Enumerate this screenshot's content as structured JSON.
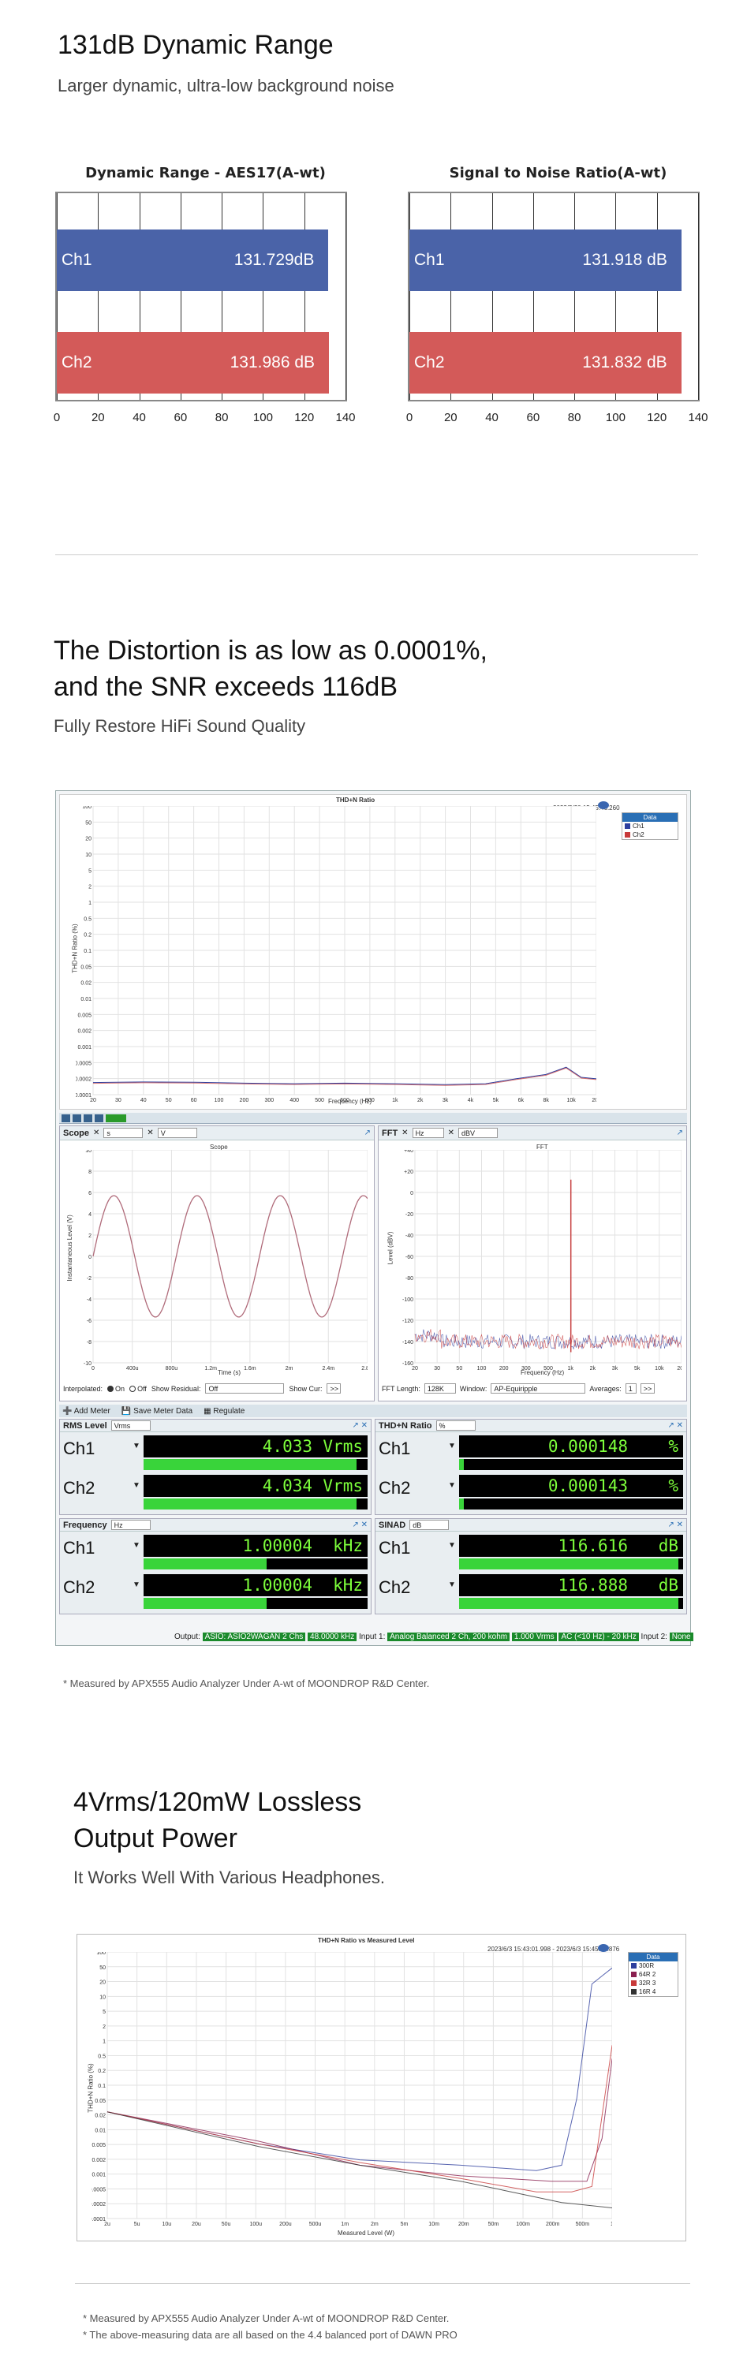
{
  "section1": {
    "title": "131dB Dynamic Range",
    "subtitle": "Larger dynamic, ultra-low background noise"
  },
  "chart_data": [
    {
      "type": "bar",
      "title": "Dynamic Range - AES17(A-wt)",
      "categories": [
        "Ch1",
        "Ch2"
      ],
      "values": [
        131.729,
        131.986
      ],
      "value_labels": [
        "131.729dB",
        "131.986 dB"
      ],
      "colors": [
        "#4a63a8",
        "#d35a59"
      ],
      "xlim": [
        0,
        140
      ],
      "ticks": [
        "0",
        "20",
        "40",
        "60",
        "80",
        "100",
        "120",
        "140"
      ]
    },
    {
      "type": "bar",
      "title": "Signal to Noise Ratio(A-wt)",
      "categories": [
        "Ch1",
        "Ch2"
      ],
      "values": [
        131.918,
        131.832
      ],
      "value_labels": [
        "131.918 dB",
        "131.832 dB"
      ],
      "colors": [
        "#4a63a8",
        "#d35a59"
      ],
      "xlim": [
        0,
        140
      ],
      "ticks": [
        "0",
        "20",
        "40",
        "60",
        "80",
        "100",
        "120",
        "140"
      ]
    }
  ],
  "section2": {
    "title_line1": "The Distortion is as low as 0.0001%,",
    "title_line2": "and the SNR exceeds 116dB",
    "subtitle": "Fully Restore HiFi Sound Quality",
    "note": "* Measured by APX555 Audio Analyzer Under A-wt of MOONDROP R&D Center."
  },
  "thdn_chart": {
    "title": "THD+N Ratio",
    "timestamp": "2023/5/30 15:45:46.260",
    "ylabel": "THD+N Ratio (%)",
    "xlabel": "Frequency (Hz)",
    "yticks": [
      "100",
      "50",
      "20",
      "10",
      "5",
      "2",
      "1",
      "0.5",
      "0.2",
      "0.1",
      "0.05",
      "0.02",
      "0.01",
      "0.005",
      "0.002",
      "0.001",
      "0.0005",
      "0.0002",
      "0.0001"
    ],
    "xticks": [
      "20",
      "30",
      "40",
      "50",
      "60",
      "100",
      "200",
      "300",
      "400",
      "500",
      "600",
      "800",
      "1k",
      "2k",
      "3k",
      "4k",
      "5k",
      "6k",
      "8k",
      "10k",
      "20k"
    ],
    "legend_title": "Data",
    "legend": [
      "Ch1",
      "Ch2"
    ]
  },
  "scope": {
    "label": "Scope",
    "unit_x": "s",
    "unit_y": "V",
    "title": "Scope",
    "ylabel": "Instantaneous Level (V)",
    "xlabel": "Time (s)",
    "yticks": [
      "10",
      "8",
      "6",
      "4",
      "2",
      "0",
      "-2",
      "-4",
      "-6",
      "-8",
      "-10"
    ],
    "xticks": [
      "0",
      "400u",
      "800u",
      "1.2m",
      "1.6m",
      "2m",
      "2.4m",
      "2.8m"
    ],
    "interpolated": "Interpolated:",
    "on": "On",
    "off": "Off",
    "show_residual": "Show Residual:",
    "residual_value": "Off",
    "show_cur": "Show Cur:"
  },
  "fft": {
    "label": "FFT",
    "unit_x": "Hz",
    "unit_y": "dBV",
    "title": "FFT",
    "ylabel": "Level (dBV)",
    "xlabel": "Frequency (Hz)",
    "yticks": [
      "+40",
      "+20",
      "0",
      "-20",
      "-40",
      "-60",
      "-80",
      "-100",
      "-120",
      "-140",
      "-160"
    ],
    "xticks": [
      "20",
      "30",
      "50",
      "100",
      "200",
      "300",
      "500",
      "1k",
      "2k",
      "3k",
      "5k",
      "10k",
      "20k"
    ],
    "fft_length_label": "FFT Length:",
    "fft_length": "128K",
    "window_label": "Window:",
    "window": "AP-Equiripple",
    "averages_label": "Averages:",
    "averages": "1"
  },
  "meters_toolbar": {
    "add_meter": "Add Meter",
    "save_meter": "Save Meter Data",
    "regulate": "Regulate"
  },
  "meters": [
    {
      "name": "RMS Level",
      "unit_sel": "Vrms",
      "ch1": "4.033",
      "ch2": "4.034",
      "unit": "Vrms",
      "fill1": 0.95,
      "fill2": 0.95
    },
    {
      "name": "THD+N Ratio",
      "unit_sel": "%",
      "ch1": "0.000148",
      "ch2": "0.000143",
      "unit": "%",
      "fill1": 0.02,
      "fill2": 0.02
    },
    {
      "name": "Frequency",
      "unit_sel": "Hz",
      "ch1": "1.00004",
      "ch2": "1.00004",
      "unit": "kHz",
      "fill1": 0.55,
      "fill2": 0.55
    },
    {
      "name": "SINAD",
      "unit_sel": "dB",
      "ch1": "116.616",
      "ch2": "116.888",
      "unit": "dB",
      "fill1": 0.98,
      "fill2": 0.98
    }
  ],
  "channels": [
    "Ch1",
    "Ch2"
  ],
  "status_bar": {
    "output_label": "Output:",
    "output_value": "ASIO: ASIO2WAGAN 2 Chs",
    "rate": "48.0000 kHz",
    "input1_label": "Input 1:",
    "input1_value": "Analog Balanced 2 Ch, 200 kohm",
    "input1_b": "1.000 Vrms",
    "input1_c": "AC (<10 Hz) - 20 kHz",
    "input2_label": "Input 2:",
    "input2_value": "None"
  },
  "section3": {
    "title_line1": "4Vrms/120mW Lossless",
    "title_line2": "Output Power",
    "subtitle": "It Works Well With Various Headphones.",
    "note1": "* Measured by APX555 Audio Analyzer Under A-wt of MOONDROP R&D Center.",
    "note2": "* The above-measuring data are all based on the 4.4 balanced port of DAWN PRO"
  },
  "thdn_level_chart": {
    "title": "THD+N Ratio vs Measured Level",
    "timestamp": "2023/6/3 15:43:01.998 - 2023/6/3 15:45:02.876",
    "ylabel": "THD+N Ratio (%)",
    "xlabel": "Measured Level (W)",
    "yticks": [
      "100",
      "50",
      "20",
      "10",
      "5",
      "2",
      "1",
      "0.5",
      "0.2",
      "0.1",
      "0.05",
      "0.02",
      "0.01",
      "0.005",
      "0.002",
      "0.001",
      "0.0005",
      "0.0002",
      "0.0001"
    ],
    "xticks": [
      "2u",
      "5u",
      "10u",
      "20u",
      "50u",
      "100u",
      "200u",
      "500u",
      "1m",
      "2m",
      "5m",
      "10m",
      "20m",
      "50m",
      "100m",
      "200m",
      "500m",
      "1"
    ],
    "legend_title": "Data",
    "legend": [
      "300R",
      "64R 2",
      "32R 3",
      "16R 4"
    ],
    "legend_colors": [
      "#2e3f9e",
      "#8a2050",
      "#c83a3a",
      "#333333"
    ]
  }
}
